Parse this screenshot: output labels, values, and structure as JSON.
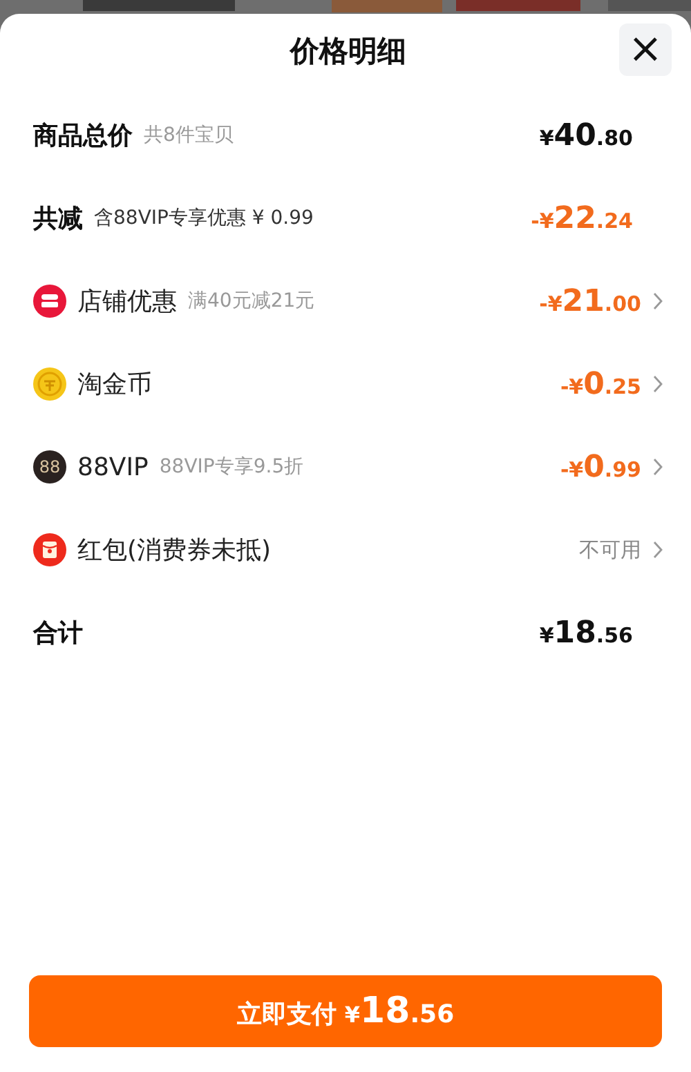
{
  "sheet": {
    "title": "价格明细",
    "close": "×"
  },
  "rows": [
    {
      "kind": "summary",
      "label": "商品总价",
      "note": "共8件宝贝",
      "note_dark": false,
      "amount": {
        "sign": "¥",
        "int": "40",
        "dec": ".80",
        "discount": false
      },
      "chevron": false
    },
    {
      "kind": "summary",
      "label": "共减",
      "note": "含88VIP专享优惠 ¥ 0.99",
      "note_dark": true,
      "amount": {
        "sign": "-¥",
        "int": "22",
        "dec": ".24",
        "discount": true
      },
      "chevron": false
    },
    {
      "kind": "item",
      "label": "店铺优惠",
      "note": "满40元减21元",
      "note_dark": false,
      "amount": {
        "sign": "-¥",
        "int": "21",
        "dec": ".00",
        "discount": true
      },
      "chevron": true
    },
    {
      "kind": "item",
      "label": "淘金币",
      "amount": {
        "sign": "-¥",
        "int": "0",
        "dec": ".25",
        "discount": true
      },
      "chevron": true
    },
    {
      "kind": "item",
      "icon_text": "88",
      "label": "88VIP",
      "note": "88VIP专享9.5折",
      "note_dark": false,
      "amount": {
        "sign": "-¥",
        "int": "0",
        "dec": ".99",
        "discount": true
      },
      "chevron": true
    },
    {
      "kind": "item",
      "label": "红包(消费券未抵)",
      "status": "不可用",
      "chevron": true
    },
    {
      "kind": "summary",
      "label": "合计",
      "amount": {
        "sign": "¥",
        "int": "18",
        "dec": ".56",
        "discount": false
      },
      "chevron": false
    }
  ],
  "pay_button": {
    "label": "立即支付",
    "sign": "¥",
    "int": "18",
    "dec": ".56"
  }
}
